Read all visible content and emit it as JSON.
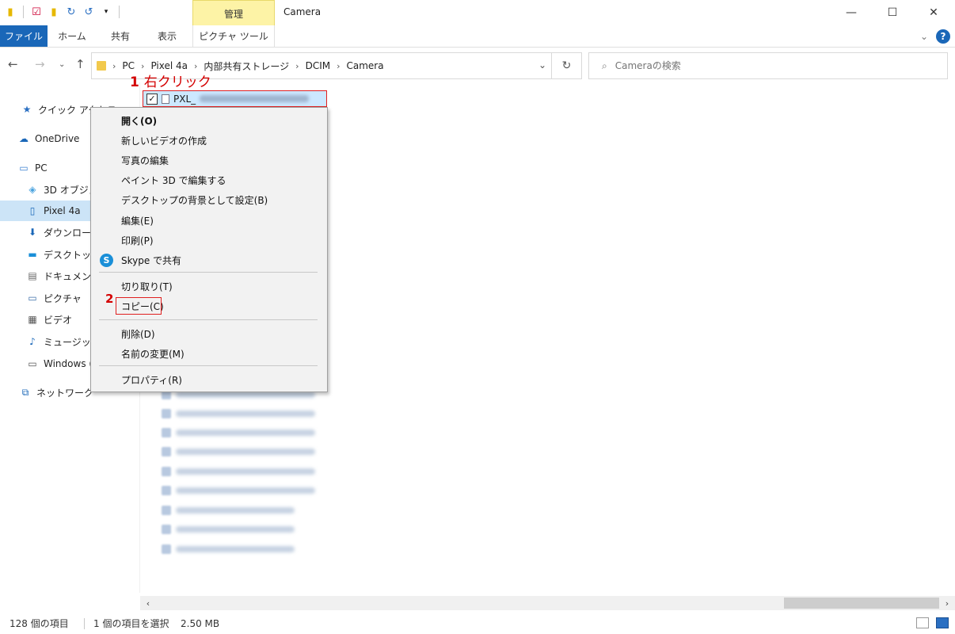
{
  "window": {
    "title": "Camera",
    "manage_tab": "管理",
    "minimize": "—",
    "maximize": "☐",
    "close": "✕"
  },
  "ribbon": {
    "file": "ファイル",
    "home": "ホーム",
    "share": "共有",
    "view": "表示",
    "picture_tools": "ピクチャ ツール",
    "help": "?"
  },
  "address": {
    "crumbs": [
      "PC",
      "Pixel 4a",
      "内部共有ストレージ",
      "DCIM",
      "Camera"
    ]
  },
  "search": {
    "placeholder": "Cameraの検索"
  },
  "sidebar": {
    "items": [
      {
        "label": "クイック アクセス",
        "icon": "star-icon"
      },
      {
        "label": "OneDrive",
        "icon": "cloud-icon"
      },
      {
        "label": "PC",
        "icon": "computer-icon"
      },
      {
        "label": "3D オブジェクト",
        "icon": "cube-icon"
      },
      {
        "label": "Pixel 4a",
        "icon": "phone-icon"
      },
      {
        "label": "ダウンロード",
        "icon": "download-icon"
      },
      {
        "label": "デスクトップ",
        "icon": "desktop-icon"
      },
      {
        "label": "ドキュメント",
        "icon": "document-icon"
      },
      {
        "label": "ピクチャ",
        "icon": "picture-icon"
      },
      {
        "label": "ビデオ",
        "icon": "video-icon"
      },
      {
        "label": "ミュージック",
        "icon": "music-icon"
      },
      {
        "label": "Windows (C:)",
        "icon": "drive-icon"
      },
      {
        "label": "ネットワーク",
        "icon": "network-icon"
      }
    ]
  },
  "selected_file": {
    "name_prefix": "PXL_"
  },
  "annotations": {
    "step1_num": "1",
    "step1_text": "右クリック",
    "step2_num": "2"
  },
  "context_menu": {
    "group1": [
      "開く(O)",
      "新しいビデオの作成",
      "写真の編集",
      "ペイント 3D で編集する",
      "デスクトップの背景として設定(B)",
      "編集(E)",
      "印刷(P)",
      "Skype で共有"
    ],
    "group2": [
      "切り取り(T)",
      "コピー(C)"
    ],
    "group3": [
      "削除(D)",
      "名前の変更(M)"
    ],
    "group4": [
      "プロパティ(R)"
    ]
  },
  "status": {
    "item_count": "128 個の項目",
    "selection": "1 個の項目を選択",
    "size": "2.50 MB"
  }
}
